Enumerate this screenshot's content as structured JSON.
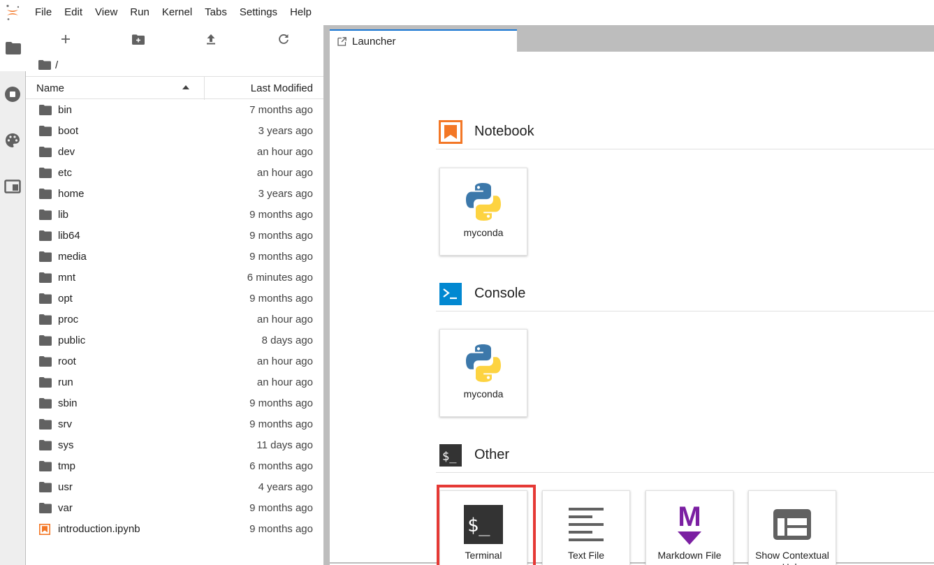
{
  "menubar": {
    "items": [
      "File",
      "Edit",
      "View",
      "Run",
      "Kernel",
      "Tabs",
      "Settings",
      "Help"
    ]
  },
  "activitybar": {
    "tabs": [
      "folder-icon",
      "running-stop-icon",
      "palette-icon",
      "tab-window-icon"
    ]
  },
  "filebrowser": {
    "toolbar": [
      "new-launcher-icon",
      "new-folder-icon",
      "upload-icon",
      "refresh-icon"
    ],
    "breadcrumb": {
      "path": "/"
    },
    "columns": {
      "name": "Name",
      "modified": "Last Modified"
    },
    "items": [
      {
        "name": "bin",
        "modified": "7 months ago",
        "type": "folder"
      },
      {
        "name": "boot",
        "modified": "3 years ago",
        "type": "folder"
      },
      {
        "name": "dev",
        "modified": "an hour ago",
        "type": "folder"
      },
      {
        "name": "etc",
        "modified": "an hour ago",
        "type": "folder"
      },
      {
        "name": "home",
        "modified": "3 years ago",
        "type": "folder"
      },
      {
        "name": "lib",
        "modified": "9 months ago",
        "type": "folder"
      },
      {
        "name": "lib64",
        "modified": "9 months ago",
        "type": "folder"
      },
      {
        "name": "media",
        "modified": "9 months ago",
        "type": "folder"
      },
      {
        "name": "mnt",
        "modified": "6 minutes ago",
        "type": "folder"
      },
      {
        "name": "opt",
        "modified": "9 months ago",
        "type": "folder"
      },
      {
        "name": "proc",
        "modified": "an hour ago",
        "type": "folder"
      },
      {
        "name": "public",
        "modified": "8 days ago",
        "type": "folder"
      },
      {
        "name": "root",
        "modified": "an hour ago",
        "type": "folder"
      },
      {
        "name": "run",
        "modified": "an hour ago",
        "type": "folder"
      },
      {
        "name": "sbin",
        "modified": "9 months ago",
        "type": "folder"
      },
      {
        "name": "srv",
        "modified": "9 months ago",
        "type": "folder"
      },
      {
        "name": "sys",
        "modified": "11 days ago",
        "type": "folder"
      },
      {
        "name": "tmp",
        "modified": "6 months ago",
        "type": "folder"
      },
      {
        "name": "usr",
        "modified": "4 years ago",
        "type": "folder"
      },
      {
        "name": "var",
        "modified": "9 months ago",
        "type": "folder"
      },
      {
        "name": "introduction.ipynb",
        "modified": "9 months ago",
        "type": "notebook"
      }
    ]
  },
  "dock": {
    "tabs": [
      {
        "label": "Launcher",
        "icon": "launcher-icon"
      }
    ]
  },
  "launcher": {
    "sections": [
      {
        "title": "Notebook",
        "icon": "notebook-icon",
        "cards": [
          {
            "label": "myconda",
            "icon": "python-icon"
          }
        ]
      },
      {
        "title": "Console",
        "icon": "console-icon",
        "cards": [
          {
            "label": "myconda",
            "icon": "python-icon"
          }
        ]
      },
      {
        "title": "Other",
        "icon": "terminal-icon",
        "cards": [
          {
            "label": "Terminal",
            "icon": "terminal-icon"
          },
          {
            "label": "Text File",
            "icon": "text-file-icon"
          },
          {
            "label": "Markdown File",
            "icon": "markdown-icon"
          },
          {
            "label": "Show Contextual Help",
            "icon": "contextual-help-icon"
          }
        ]
      }
    ]
  },
  "colors": {
    "accent": "#1976d2",
    "notebook": "#f37726",
    "console": "#0288d1",
    "markdown": "#7b1fa2",
    "highlight": "#e53935",
    "icon": "#616161"
  }
}
